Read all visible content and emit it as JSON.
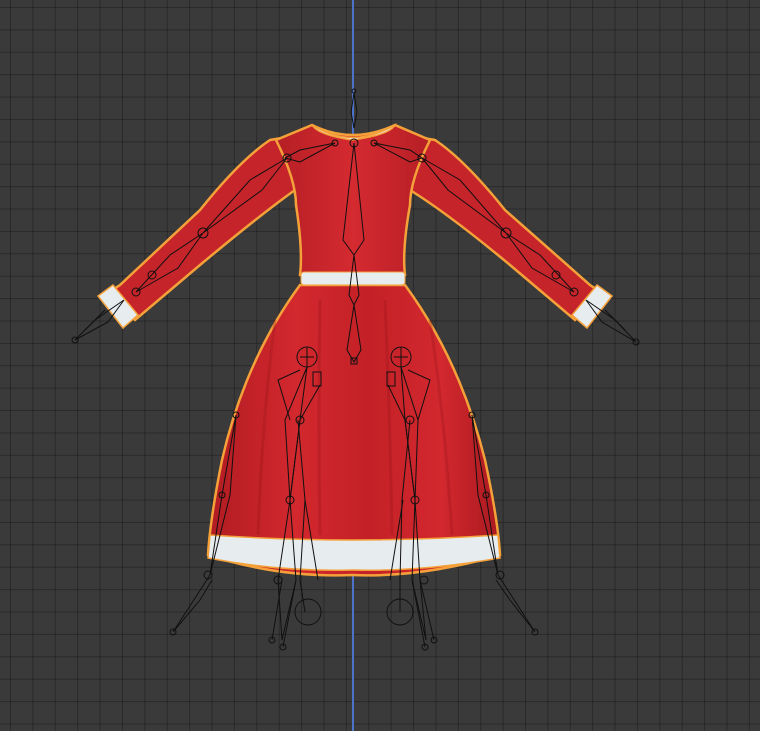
{
  "viewport": {
    "grid_color": "#2a2a2a",
    "background_color": "#3a3a3a",
    "axis_color": "#4d73c9"
  },
  "model": {
    "dress_color": "#c8232a",
    "fur_trim_color": "#e7ecef",
    "outline_color": "#f5a13a",
    "selected": true
  },
  "armature": {
    "bone_color": "#101010",
    "display": "octahedral"
  }
}
